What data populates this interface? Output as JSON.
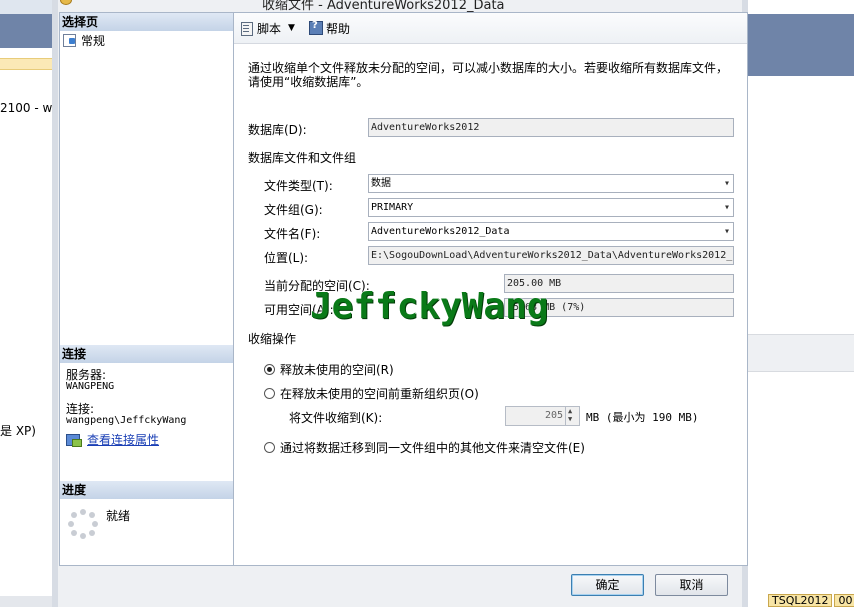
{
  "background": {
    "left_fragments": [
      "2100 - w",
      "是 XP)"
    ],
    "status_tabs": [
      "TSQL2012",
      "00"
    ]
  },
  "dialog": {
    "title_fragment": "收缩文件 - AdventureWorks2012_Data",
    "left_panel": {
      "select_page_header": "选择页",
      "pages": [
        "常规"
      ],
      "connection_header": "连接",
      "server_label": "服务器:",
      "server_value": "WANGPENG",
      "connection_label": "连接:",
      "connection_value": "wangpeng\\JeffckyWang",
      "view_connection_properties": "查看连接属性",
      "progress_header": "进度",
      "progress_status": "就绪"
    },
    "toolbar": {
      "script_label": "脚本",
      "help_label": "帮助"
    },
    "description": "通过收缩单个文件释放未分配的空间，可以减小数据库的大小。若要收缩所有数据库文件，请使用“收缩数据库”。",
    "database_label": "数据库(D):",
    "database_value": "AdventureWorks2012",
    "files_group_heading": "数据库文件和文件组",
    "file_type_label": "文件类型(T):",
    "file_type_value": "数据",
    "filegroup_label": "文件组(G):",
    "filegroup_value": "PRIMARY",
    "file_name_label": "文件名(F):",
    "file_name_value": "AdventureWorks2012_Data",
    "location_label": "位置(L):",
    "location_value": "E:\\SogouDownLoad\\AdventureWorks2012_Data\\AdventureWorks2012_",
    "allocated_label": "当前分配的空间(C):",
    "allocated_value": "205.00 MB",
    "available_label": "可用空间(A):",
    "available_value": "15.63 MB (7%)",
    "shrink_heading": "收缩操作",
    "options": {
      "release_unused": "释放未使用的空间(R)",
      "reorganize": "在释放未使用的空间前重新组织页(O)",
      "empty_file": "通过将数据迁移到同一文件组中的其他文件来清空文件(E)"
    },
    "shrink_to_label": "将文件收缩到(K):",
    "shrink_to_value": "205",
    "shrink_to_unit": "MB (最小为 190 MB)",
    "ok_label": "确定",
    "cancel_label": "取消",
    "watermark": "JeffckyWang"
  }
}
